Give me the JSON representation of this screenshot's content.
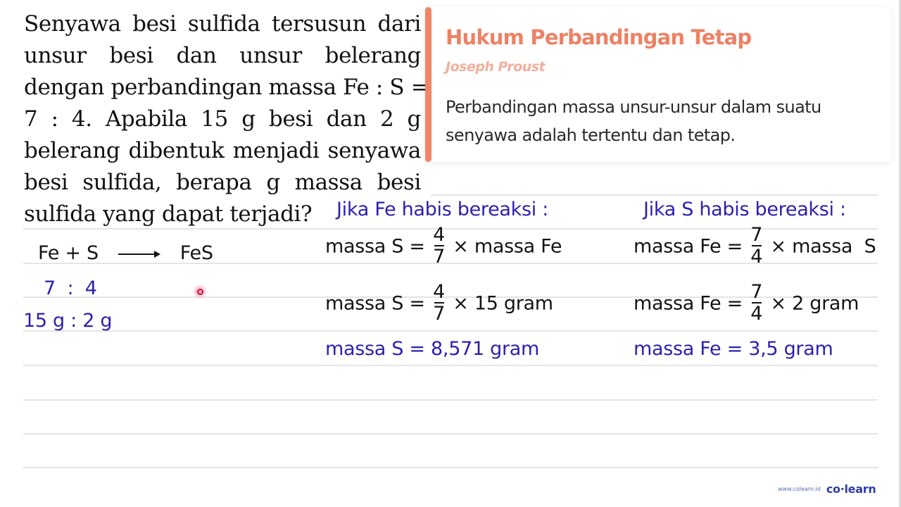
{
  "question": {
    "lines": [
      "Senyawa besi sulfida tersusun dari",
      "unsur besi dan unsur belerang",
      "dengan perbandingan massa Fe : S =",
      "7 : 4. Apabila 15 g besi dan 2 g",
      "belerang dibentuk menjadi senyawa",
      "besi sulfida, berapa g massa besi",
      "sulfida yang dapat terjadi?"
    ]
  },
  "card": {
    "title": "Hukum Perbandingan Tetap",
    "subtitle": "Joseph Proust",
    "body_lines": [
      "Perbandingan massa unsur-unsur dalam suatu",
      "senyawa adalah tertentu dan tetap."
    ],
    "accent_color": "#f28468"
  },
  "reaction": {
    "reactants": "Fe + S",
    "arrow_icon": "right-arrow",
    "product": "FeS",
    "ratio": "7  :  4",
    "given": "15 g : 2 g"
  },
  "case_fe": {
    "heading": "Jika Fe habis bereaksi :",
    "step1": {
      "left": "massa S =",
      "num": "4",
      "den": "7",
      "right": "× massa Fe"
    },
    "step2": {
      "left": "massa S =",
      "num": "4",
      "den": "7",
      "right": "× 15 gram"
    },
    "result": "massa S = 8,571 gram"
  },
  "case_s": {
    "heading": "Jika S habis bereaksi :",
    "step1": {
      "left": "massa Fe =",
      "num": "7",
      "den": "4",
      "right": "× massa  S"
    },
    "step2": {
      "left": "massa Fe =",
      "num": "7",
      "den": "4",
      "right": "× 2 gram"
    },
    "result": "massa Fe = 3,5 gram"
  },
  "brand": {
    "url": "www.colearn.id",
    "logo": "co·learn"
  },
  "colors": {
    "ink_black": "#141414",
    "ink_blue": "#2c1fb0",
    "card_title": "#ec8266"
  }
}
